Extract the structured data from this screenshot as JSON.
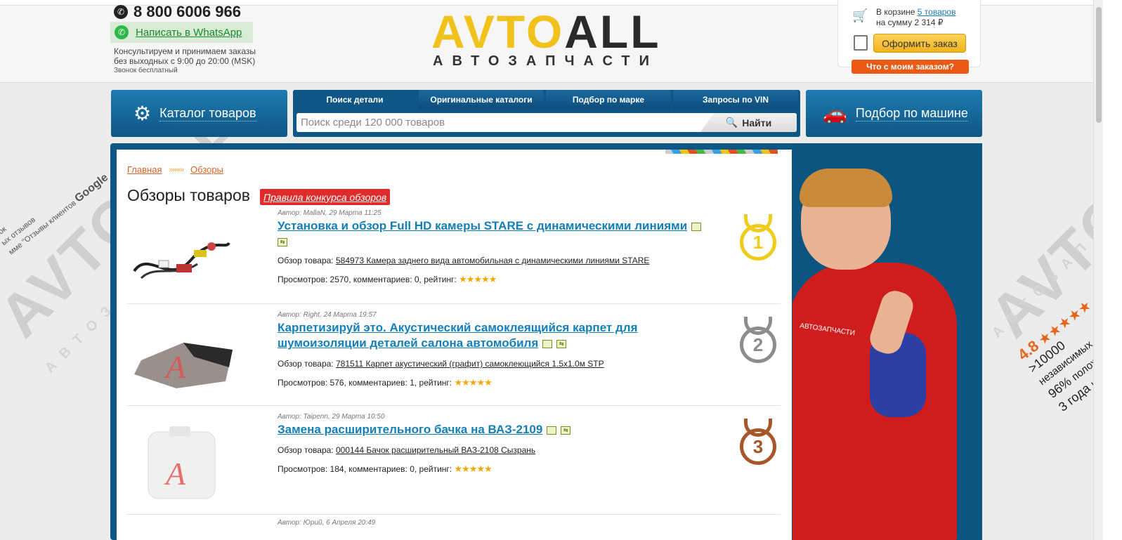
{
  "header": {
    "phone": "8 800 6006 966",
    "whatsapp_label": "Написать в WhatsApp",
    "consult_line1": "Консультируем и принимаем заказы",
    "consult_line2": "без выходных с 9:00 до 20:00 (MSK)",
    "consult_note": "Звонок бесплатный",
    "logo_part1": "AVTO",
    "logo_part2": "ALL",
    "logo_sub": "АВТОЗАПЧАСТИ",
    "cart_prefix": "В корзине",
    "cart_items_link": "5 товаров",
    "cart_sum": "на сумму 2 314 ₽",
    "order_button": "Оформить заказ",
    "order_status_button": "Что с моим заказом?"
  },
  "nav": {
    "catalog_label": "Каталог товаров",
    "by_car_label": "Подбор по машине",
    "tabs": [
      "Поиск детали",
      "Оригинальные каталоги",
      "Подбор по марке",
      "Запросы по VIN"
    ],
    "search_placeholder": "Поиск среди 120 000 товаров",
    "search_button": "Найти"
  },
  "breadcrumb": {
    "home": "Главная",
    "sep": "»»»»",
    "current": "Обзоры"
  },
  "page": {
    "title": "Обзоры товаров",
    "rules_link": "Правила конкурса обзоров"
  },
  "reviews": [
    {
      "author": "Автор: MallaN, 29 Марта 11:25",
      "title": "Установка и обзор Full HD камеры STARE с динамическими линиями",
      "product_prefix": "Обзор товара:",
      "product_link": "584973 Камера заднего вида автомобильная с динамическими линиями STARE",
      "stats": "Просмотров: 2570, комментариев: 0, рейтинг:",
      "rating": 5,
      "medal": "1"
    },
    {
      "author": "Автор: Right, 24 Марта 19:57",
      "title": "Карпетизируй это. Акустический самоклеящийся карпет для шумоизоляции деталей салона автомобиля",
      "product_prefix": "Обзор товара:",
      "product_link": "781511 Карпет акустический (графит) самоклеющийся 1.5х1.0м STP",
      "stats": "Просмотров: 576, комментариев: 1, рейтинг:",
      "rating": 5,
      "medal": "2"
    },
    {
      "author": "Автор: Taipenn, 29 Марта 10:50",
      "title": "Замена расширительного бачка на ВАЗ-2109",
      "product_prefix": "Обзор товара:",
      "product_link": "000144 Бачок расширительный ВАЗ-2108 Сызрань",
      "stats": "Просмотров: 184, комментариев: 0, рейтинг:",
      "rating": 5,
      "medal": "3"
    },
    {
      "author": "Автор: Юрий, 6 Апреля 20:49"
    }
  ],
  "side_badges": {
    "left_lines": [
      "нок",
      "ых отзывов",
      "мме \"Отзывы клиентов"
    ],
    "left_google": "Google",
    "right_score": "4.8",
    "right_stars": "★★★★★",
    "right_lines": [
      ">10000",
      "96%",
      "3 года"
    ],
    "right_small": [
      "независимых",
      "положите",
      "на"
    ]
  },
  "promo": {
    "badge_text": "АВТОЗАПЧАСТИ"
  },
  "watermark": {
    "text": "AVTOALL",
    "sub": "АВТОЗАПЧАСТИ"
  }
}
